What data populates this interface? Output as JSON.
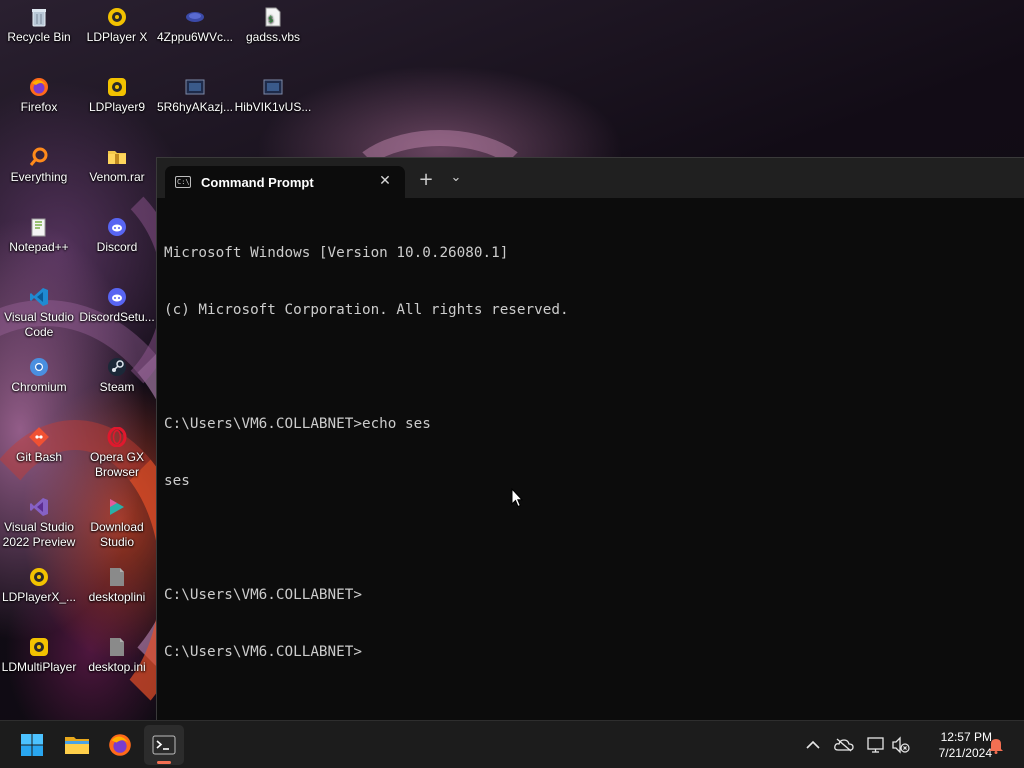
{
  "desktop": {
    "icons": [
      {
        "label": "Recycle Bin",
        "icon": "recycle-bin-icon"
      },
      {
        "label": "LDPlayer X",
        "icon": "ldplayer-icon"
      },
      {
        "label": "4Zppu6WVc...",
        "icon": "file-icon"
      },
      {
        "label": "gadss.vbs",
        "icon": "vbs-script-icon"
      },
      {
        "label": "Firefox",
        "icon": "firefox-icon"
      },
      {
        "label": "LDPlayer9",
        "icon": "ldplayer-icon"
      },
      {
        "label": "5R6hyAKazj...",
        "icon": "image-file-icon"
      },
      {
        "label": "HibVIK1vUS...",
        "icon": "image-file-icon"
      },
      {
        "label": "Everything",
        "icon": "everything-search-icon"
      },
      {
        "label": "Venom.rar",
        "icon": "folder-archive-icon"
      },
      {
        "label": "Notepad++",
        "icon": "notepad-plus-plus-icon"
      },
      {
        "label": "Discord",
        "icon": "discord-icon"
      },
      {
        "label": "Visual Studio Code",
        "icon": "vscode-icon"
      },
      {
        "label": "DiscordSetu...",
        "icon": "discord-icon"
      },
      {
        "label": "Chromium",
        "icon": "chromium-icon"
      },
      {
        "label": "Steam",
        "icon": "steam-icon"
      },
      {
        "label": "Git Bash",
        "icon": "git-bash-icon"
      },
      {
        "label": "Opera GX Browser",
        "icon": "opera-gx-icon"
      },
      {
        "label": "Visual Studio 2022 Preview",
        "icon": "visual-studio-icon"
      },
      {
        "label": "Download Studio",
        "icon": "download-studio-icon"
      },
      {
        "label": "LDPlayerX_...",
        "icon": "ldplayer-icon"
      },
      {
        "label": "desktoplini",
        "icon": "settings-file-icon"
      },
      {
        "label": "LDMultiPlayer",
        "icon": "ldplayer-icon"
      },
      {
        "label": "desktop.ini",
        "icon": "settings-file-icon"
      }
    ]
  },
  "terminal": {
    "tab_title": "Command Prompt",
    "new_tab_glyph": "+",
    "dropdown_glyph": "⌄",
    "close_glyph": "✕",
    "lines": [
      "Microsoft Windows [Version 10.0.26080.1]",
      "(c) Microsoft Corporation. All rights reserved.",
      "",
      "C:\\Users\\VM6.COLLABNET>echo ses",
      "ses",
      "",
      "C:\\Users\\VM6.COLLABNET>",
      "C:\\Users\\VM6.COLLABNET>"
    ]
  },
  "taskbar": {
    "apps": [
      "start-icon",
      "file-explorer-icon",
      "firefox-icon",
      "terminal-icon"
    ],
    "active_app": "terminal-icon",
    "tray": [
      "chevron-up-icon",
      "onedrive-offline-icon",
      "network-icon",
      "volume-muted-icon",
      "notification-bell-icon"
    ],
    "time": "12:57 PM",
    "date": "7/21/2024",
    "accent_color": "#f36f52"
  }
}
